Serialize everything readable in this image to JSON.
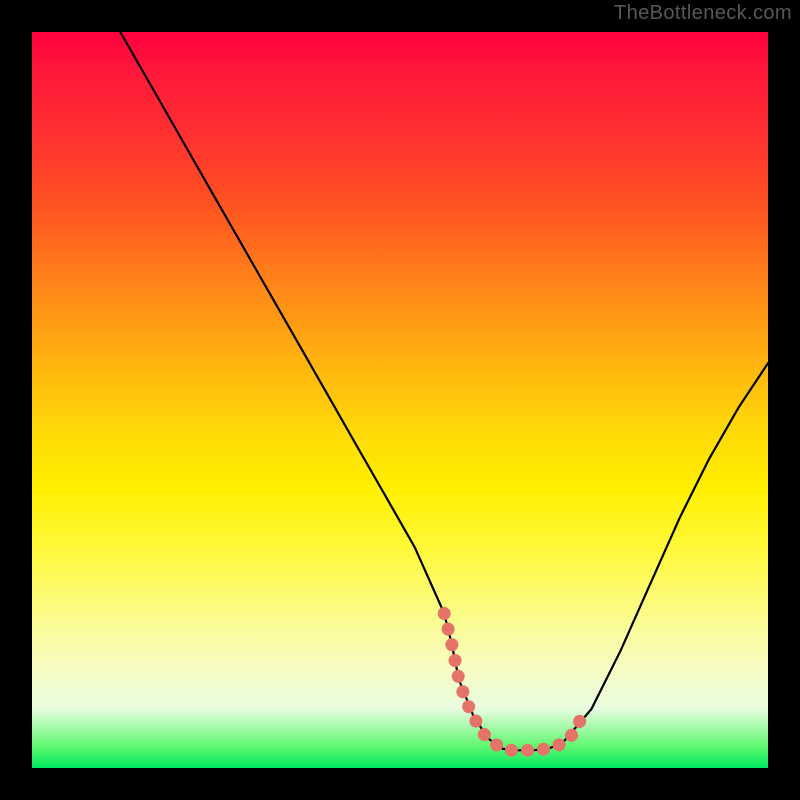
{
  "watermark": "TheBottleneck.com",
  "chart_data": {
    "type": "line",
    "title": "",
    "xlabel": "",
    "ylabel": "",
    "xlim": [
      0,
      100
    ],
    "ylim": [
      0,
      100
    ],
    "series": [
      {
        "name": "black-curve",
        "color": "#000000",
        "x": [
          12,
          16,
          20,
          24,
          28,
          32,
          36,
          40,
          44,
          48,
          52,
          56,
          57,
          58,
          60,
          62,
          64,
          66,
          68,
          70,
          72,
          76,
          80,
          84,
          88,
          92,
          96,
          100
        ],
        "y": [
          100,
          93,
          86,
          79,
          72,
          65,
          58,
          51,
          44,
          37,
          30,
          21,
          17,
          12,
          7,
          4,
          2.6,
          2.4,
          2.4,
          2.6,
          3.3,
          8,
          16,
          25,
          34,
          42,
          49,
          55
        ]
      },
      {
        "name": "salmon-marker",
        "color": "#e57368",
        "x": [
          56.0,
          57.0,
          58.0,
          59.0,
          60.0,
          61.0,
          62.0,
          63.0,
          64.0,
          65.0,
          66.0,
          67.0,
          68.0,
          69.0,
          70.0,
          71.0,
          72.0,
          73.0,
          73.8,
          74.5
        ],
        "y": [
          21.0,
          17.0,
          12.0,
          9.0,
          7.0,
          5.0,
          4.0,
          3.2,
          2.6,
          2.4,
          2.4,
          2.4,
          2.4,
          2.5,
          2.6,
          2.9,
          3.3,
          4.0,
          5.2,
          6.5
        ]
      }
    ]
  }
}
